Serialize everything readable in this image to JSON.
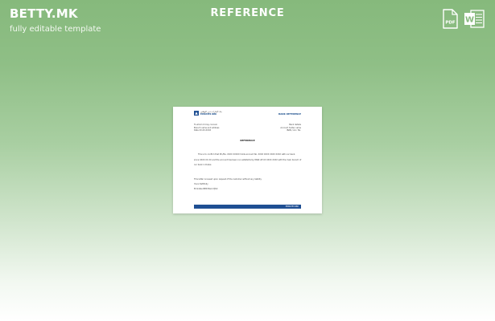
{
  "brand": {
    "logo": "BETTY.MK",
    "tagline": "fully editable template"
  },
  "page_title": "REFERENCE",
  "formats": [
    {
      "name": "pdf-icon",
      "label": "PDF",
      "color": "#ffffff"
    },
    {
      "name": "word-icon",
      "label": "W",
      "color": "#ffffff"
    }
  ],
  "document": {
    "bank_name_arabic": "بنك الإمارات دبي الوطني",
    "bank_name": "EMIRATES NBD",
    "doc_type": "BANK REFERENCE",
    "sender_lines": [
      "To whom it may concern",
      "Branch name and address",
      "Date XX.XX.XXXX"
    ],
    "recipient_lines": [
      "Bank details",
      "Account holder name",
      "IBAN / Acc. No."
    ],
    "title": "REFERENCE",
    "body_lines": [
      "This is to confirm that Mr./Ms. XXXX XXXXX holds account No. XXXX XXXX XXXX XXXX with our bank.",
      "since XXXX XX XX and the account has been run satisfactorily. IBAN AE XX XXXX XXXX with the main branch of",
      "our bank in Dubai."
    ],
    "closing_lines": [
      "This letter is issued upon request of the customer without any liability",
      "Yours faithfully",
      "Emirates NBD Bank PJSC"
    ],
    "footer": "EMIRATES NBD"
  },
  "colors": {
    "accent_blue": "#1f4f93",
    "background_green": "#86b97c"
  }
}
